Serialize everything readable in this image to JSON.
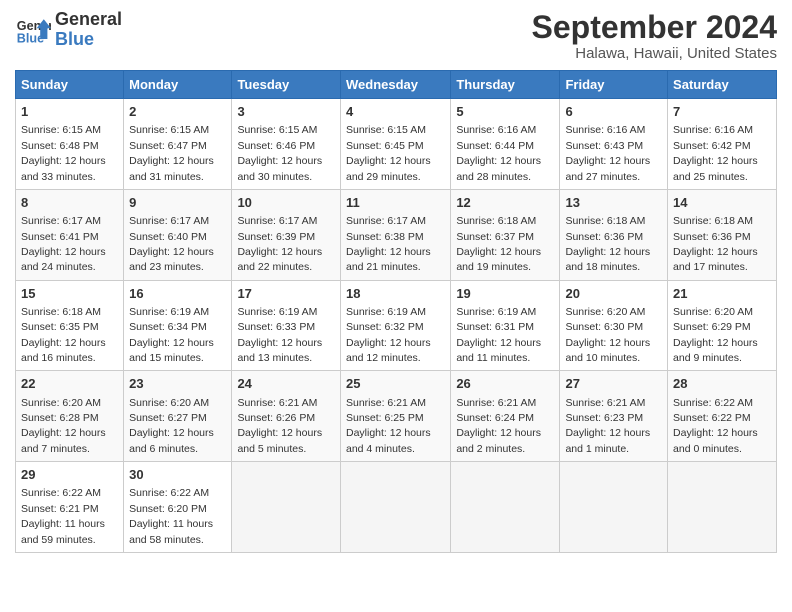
{
  "logo": {
    "line1": "General",
    "line2": "Blue"
  },
  "title": "September 2024",
  "subtitle": "Halawa, Hawaii, United States",
  "days_of_week": [
    "Sunday",
    "Monday",
    "Tuesday",
    "Wednesday",
    "Thursday",
    "Friday",
    "Saturday"
  ],
  "weeks": [
    [
      {
        "day": 1,
        "sunrise": "6:15 AM",
        "sunset": "6:48 PM",
        "daylight": "12 hours and 33 minutes."
      },
      {
        "day": 2,
        "sunrise": "6:15 AM",
        "sunset": "6:47 PM",
        "daylight": "12 hours and 31 minutes."
      },
      {
        "day": 3,
        "sunrise": "6:15 AM",
        "sunset": "6:46 PM",
        "daylight": "12 hours and 30 minutes."
      },
      {
        "day": 4,
        "sunrise": "6:15 AM",
        "sunset": "6:45 PM",
        "daylight": "12 hours and 29 minutes."
      },
      {
        "day": 5,
        "sunrise": "6:16 AM",
        "sunset": "6:44 PM",
        "daylight": "12 hours and 28 minutes."
      },
      {
        "day": 6,
        "sunrise": "6:16 AM",
        "sunset": "6:43 PM",
        "daylight": "12 hours and 27 minutes."
      },
      {
        "day": 7,
        "sunrise": "6:16 AM",
        "sunset": "6:42 PM",
        "daylight": "12 hours and 25 minutes."
      }
    ],
    [
      {
        "day": 8,
        "sunrise": "6:17 AM",
        "sunset": "6:41 PM",
        "daylight": "12 hours and 24 minutes."
      },
      {
        "day": 9,
        "sunrise": "6:17 AM",
        "sunset": "6:40 PM",
        "daylight": "12 hours and 23 minutes."
      },
      {
        "day": 10,
        "sunrise": "6:17 AM",
        "sunset": "6:39 PM",
        "daylight": "12 hours and 22 minutes."
      },
      {
        "day": 11,
        "sunrise": "6:17 AM",
        "sunset": "6:38 PM",
        "daylight": "12 hours and 21 minutes."
      },
      {
        "day": 12,
        "sunrise": "6:18 AM",
        "sunset": "6:37 PM",
        "daylight": "12 hours and 19 minutes."
      },
      {
        "day": 13,
        "sunrise": "6:18 AM",
        "sunset": "6:36 PM",
        "daylight": "12 hours and 18 minutes."
      },
      {
        "day": 14,
        "sunrise": "6:18 AM",
        "sunset": "6:36 PM",
        "daylight": "12 hours and 17 minutes."
      }
    ],
    [
      {
        "day": 15,
        "sunrise": "6:18 AM",
        "sunset": "6:35 PM",
        "daylight": "12 hours and 16 minutes."
      },
      {
        "day": 16,
        "sunrise": "6:19 AM",
        "sunset": "6:34 PM",
        "daylight": "12 hours and 15 minutes."
      },
      {
        "day": 17,
        "sunrise": "6:19 AM",
        "sunset": "6:33 PM",
        "daylight": "12 hours and 13 minutes."
      },
      {
        "day": 18,
        "sunrise": "6:19 AM",
        "sunset": "6:32 PM",
        "daylight": "12 hours and 12 minutes."
      },
      {
        "day": 19,
        "sunrise": "6:19 AM",
        "sunset": "6:31 PM",
        "daylight": "12 hours and 11 minutes."
      },
      {
        "day": 20,
        "sunrise": "6:20 AM",
        "sunset": "6:30 PM",
        "daylight": "12 hours and 10 minutes."
      },
      {
        "day": 21,
        "sunrise": "6:20 AM",
        "sunset": "6:29 PM",
        "daylight": "12 hours and 9 minutes."
      }
    ],
    [
      {
        "day": 22,
        "sunrise": "6:20 AM",
        "sunset": "6:28 PM",
        "daylight": "12 hours and 7 minutes."
      },
      {
        "day": 23,
        "sunrise": "6:20 AM",
        "sunset": "6:27 PM",
        "daylight": "12 hours and 6 minutes."
      },
      {
        "day": 24,
        "sunrise": "6:21 AM",
        "sunset": "6:26 PM",
        "daylight": "12 hours and 5 minutes."
      },
      {
        "day": 25,
        "sunrise": "6:21 AM",
        "sunset": "6:25 PM",
        "daylight": "12 hours and 4 minutes."
      },
      {
        "day": 26,
        "sunrise": "6:21 AM",
        "sunset": "6:24 PM",
        "daylight": "12 hours and 2 minutes."
      },
      {
        "day": 27,
        "sunrise": "6:21 AM",
        "sunset": "6:23 PM",
        "daylight": "12 hours and 1 minute."
      },
      {
        "day": 28,
        "sunrise": "6:22 AM",
        "sunset": "6:22 PM",
        "daylight": "12 hours and 0 minutes."
      }
    ],
    [
      {
        "day": 29,
        "sunrise": "6:22 AM",
        "sunset": "6:21 PM",
        "daylight": "11 hours and 59 minutes."
      },
      {
        "day": 30,
        "sunrise": "6:22 AM",
        "sunset": "6:20 PM",
        "daylight": "11 hours and 58 minutes."
      },
      null,
      null,
      null,
      null,
      null
    ]
  ]
}
